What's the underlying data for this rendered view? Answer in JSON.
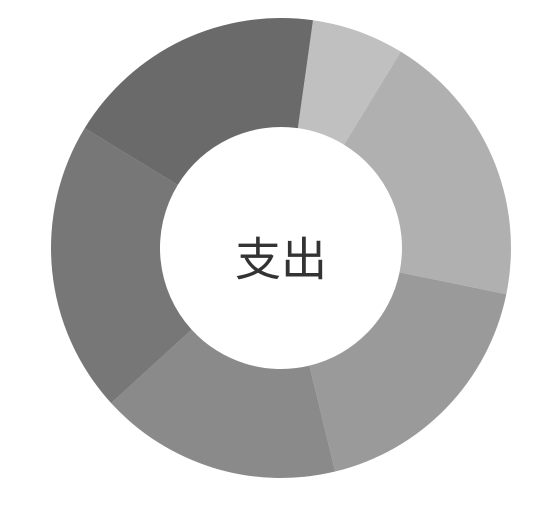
{
  "chart_data": {
    "type": "pie",
    "donut": true,
    "center_label": "支出",
    "categories": [],
    "values": [
      6.5,
      19.5,
      18.0,
      17.0,
      20.5,
      18.5
    ],
    "colors": [
      "#c0c0c0",
      "#b0b0b0",
      "#9a9a9a",
      "#8a8a8a",
      "#777777",
      "#6a6a6a"
    ]
  }
}
